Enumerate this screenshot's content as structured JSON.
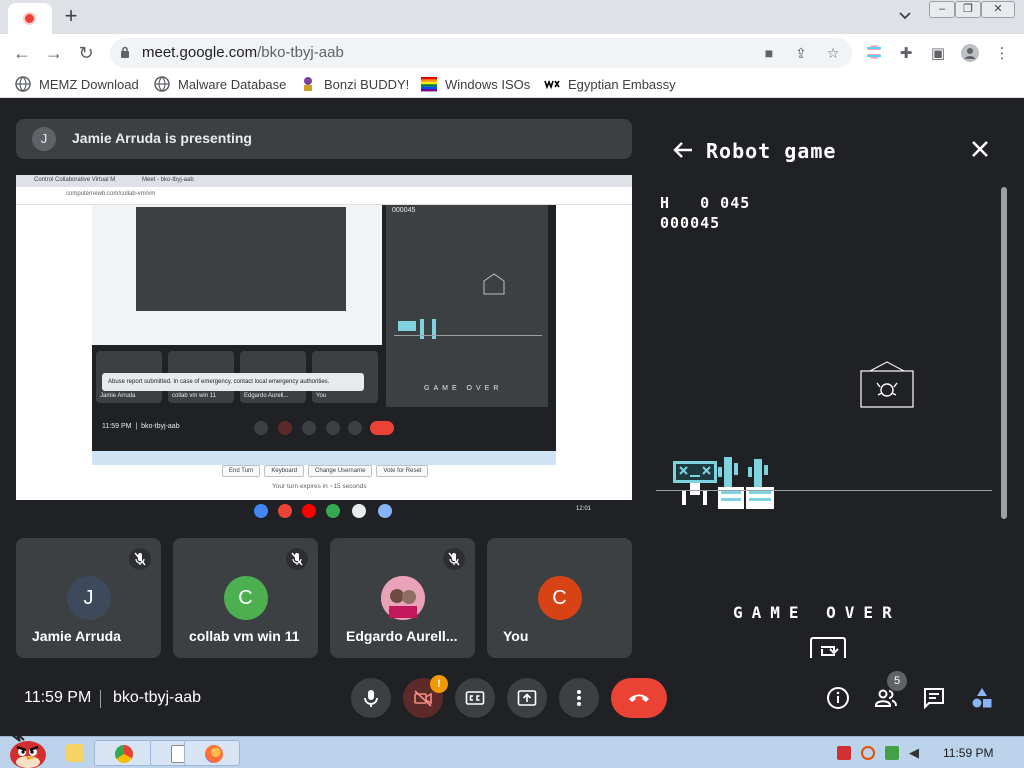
{
  "browser": {
    "url_host": "meet.google.com",
    "url_path": "/bko-tbyj-aab",
    "bookmarks": [
      {
        "label": "MEMZ Download"
      },
      {
        "label": "Malware Database"
      },
      {
        "label": "Bonzi BUDDY!"
      },
      {
        "label": "Windows ISOs"
      },
      {
        "label": "Egyptian Embassy"
      }
    ]
  },
  "meet": {
    "presenting_initial": "J",
    "presenting_text": "Jamie Arruda is presenting",
    "shared_screen": {
      "tab1": "Control Collaborative Virtual M",
      "tab2": "Meet - bko-tbyj-aab",
      "url": "computernewb.com/collab-vm/vm",
      "toast": "Abuse report submitted. In case of emergency, contact local emergency authorities.",
      "tiles": [
        "Jamie Arruda",
        "collab vm win 11",
        "Edgardo Aurell...",
        "You"
      ],
      "time": "11:59 PM",
      "code": "bko-tbyj-aab",
      "score": "000045",
      "gameover": "GAME OVER",
      "buttons": [
        "End Turn",
        "Keyboard",
        "Change Username",
        "Vote for Reset"
      ],
      "note": "Your turn expires in ~15 seconds",
      "tray_time": "12:01"
    },
    "participants": [
      {
        "initial": "J",
        "name": "Jamie Arruda",
        "color": "#3c4a5c"
      },
      {
        "initial": "C",
        "name": "collab vm win 11",
        "color": "#4caf50"
      },
      {
        "initial": "",
        "name": "Edgardo Aurell...",
        "color": "#d98aa0"
      },
      {
        "initial": "C",
        "name": "You",
        "color": "#d84315"
      }
    ],
    "time": "11:59 PM",
    "meeting_code": "bko-tbyj-aab",
    "camera_badge": "!",
    "people_count": "5"
  },
  "panel": {
    "title": "Robot game",
    "hiscore": "H   0 045",
    "score": "000045",
    "gameover": "GAME OVER"
  },
  "taskbar": {
    "clock": "11:59 PM"
  }
}
